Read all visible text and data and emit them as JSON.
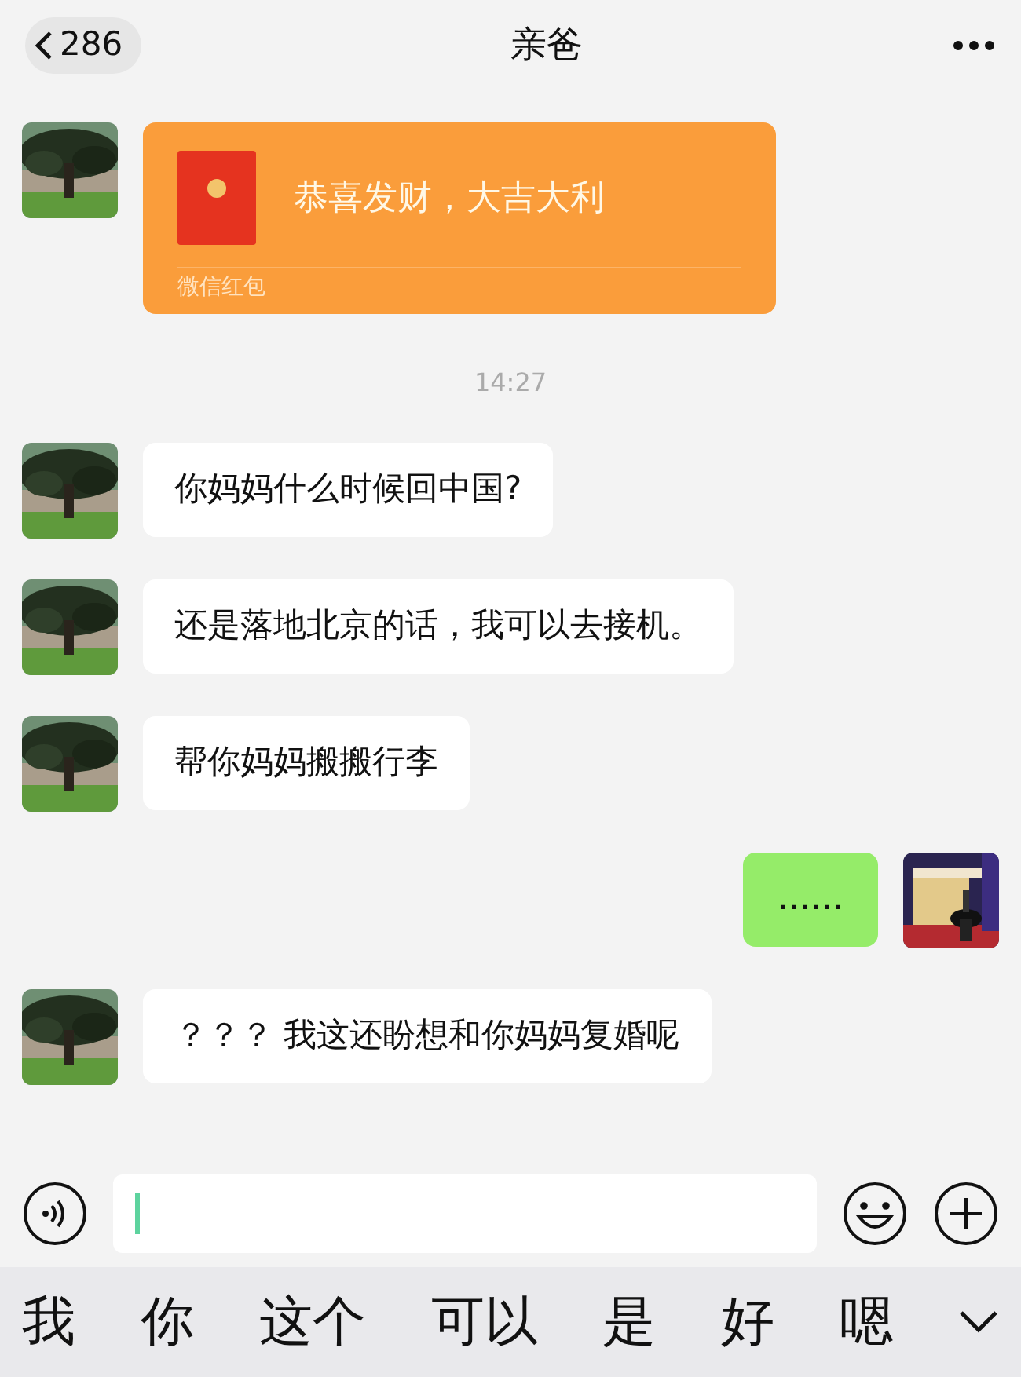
{
  "header": {
    "back_count": "286",
    "title": "亲爸"
  },
  "messages": [
    {
      "kind": "red_packet",
      "outgoing": false,
      "text": "恭喜发财，大吉大利",
      "footer": "微信红包"
    },
    {
      "kind": "time",
      "text": "14:27"
    },
    {
      "kind": "text",
      "outgoing": false,
      "text": "你妈妈什么时候回中国?"
    },
    {
      "kind": "text",
      "outgoing": false,
      "text": "还是落地北京的话，我可以去接机。"
    },
    {
      "kind": "text",
      "outgoing": false,
      "text": "帮你妈妈搬搬行李"
    },
    {
      "kind": "text",
      "outgoing": true,
      "text": "……"
    },
    {
      "kind": "text",
      "outgoing": false,
      "text": "？？？ 我这还盼想和你妈妈复婚呢"
    }
  ],
  "candidates": [
    "我",
    "你",
    "这个",
    "可以",
    "是",
    "好",
    "嗯"
  ]
}
